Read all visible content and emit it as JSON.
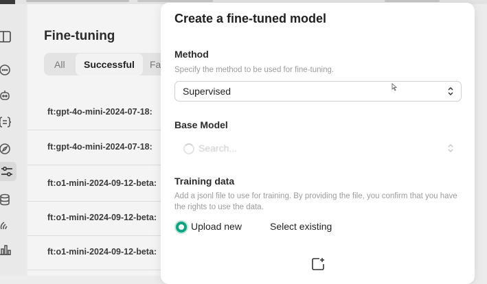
{
  "background": {
    "page_title": "Fine-tuning",
    "filters": [
      "All",
      "Successful",
      "Fa"
    ],
    "selected_filter": "Successful",
    "jobs": [
      "ft:gpt-4o-mini-2024-07-18:",
      "ft:gpt-4o-mini-2024-07-18:",
      "ft:o1-mini-2024-09-12-beta:",
      "ft:o1-mini-2024-09-12-beta:",
      "ft:o1-mini-2024-09-12-beta:"
    ]
  },
  "sidebar": {
    "icons": [
      "panel-toggle-icon",
      "chat-icon",
      "assistant-bot-icon",
      "batches-icon",
      "compass-icon",
      "fine-tuning-sliders-icon",
      "storage-icon",
      "audio-icon",
      "usage-bar-chart-icon"
    ],
    "active": "fine-tuning-sliders-icon"
  },
  "modal": {
    "title": "Create a fine-tuned model",
    "method": {
      "label": "Method",
      "help": "Specify the method to be used for fine-tuning.",
      "value": "Supervised"
    },
    "base_model": {
      "label": "Base Model",
      "placeholder": "Search..."
    },
    "training_data": {
      "label": "Training data",
      "help": "Add a jsonl file to use for training. By providing the file, you confirm that you have the rights to use the data.",
      "options": [
        "Upload new",
        "Select existing"
      ],
      "selected": "Upload new"
    }
  },
  "colors": {
    "accent_green": "#10a37f",
    "modal_bg": "#ffffff",
    "page_bg": "#f4f4f4"
  }
}
